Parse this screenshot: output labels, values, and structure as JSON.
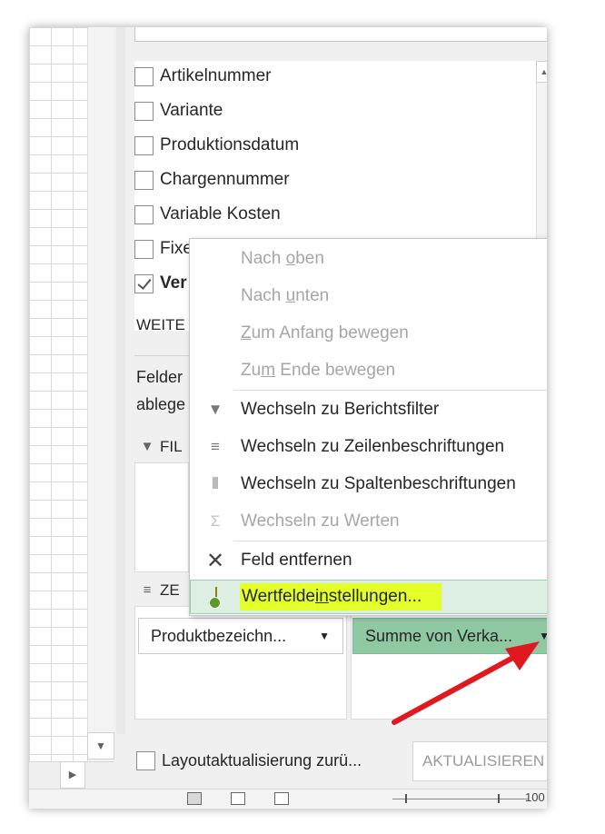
{
  "field_list": {
    "fields": [
      {
        "label": "Artikelnummer",
        "checked": false
      },
      {
        "label": "Variante",
        "checked": false
      },
      {
        "label": "Produktionsdatum",
        "checked": false
      },
      {
        "label": "Chargennummer",
        "checked": false
      },
      {
        "label": "Variable Kosten",
        "checked": false
      },
      {
        "label": "Fixe",
        "checked": false
      },
      {
        "label": "Ver",
        "checked": true
      }
    ],
    "more_tables": "WEITE"
  },
  "instructions": {
    "line1": "Felder",
    "line2": "ablege"
  },
  "areas": {
    "filter_header": "FIL",
    "rows_header": "ZE",
    "row_chip": "Produktbezeichn...",
    "value_chip": "Summe von Verka..."
  },
  "context_menu": {
    "items": [
      {
        "pre": "Nach ",
        "ul": "o",
        "post": "ben",
        "icon": "",
        "disabled": true
      },
      {
        "pre": "Nach ",
        "ul": "u",
        "post": "nten",
        "icon": "",
        "disabled": true
      },
      {
        "pre": "",
        "ul": "Z",
        "post": "um Anfang bewegen",
        "icon": "",
        "disabled": true
      },
      {
        "pre": "Zu",
        "ul": "m",
        "post": " Ende bewegen",
        "icon": "",
        "disabled": true
      },
      {
        "pre": "Wechseln zu Berichtsfilter",
        "ul": "",
        "post": "",
        "icon": "filter-icon",
        "disabled": false
      },
      {
        "pre": "Wechseln zu Zeilenbeschriftungen",
        "ul": "",
        "post": "",
        "icon": "rows-icon",
        "disabled": false
      },
      {
        "pre": "Wechseln zu Spaltenbeschriftungen",
        "ul": "",
        "post": "",
        "icon": "columns-icon",
        "disabled": false
      },
      {
        "pre": "Wechseln zu Werten",
        "ul": "",
        "post": "",
        "icon": "sigma-icon",
        "disabled": true
      },
      {
        "pre": "Feld entfernen",
        "ul": "",
        "post": "",
        "icon": "remove-icon",
        "disabled": false
      },
      {
        "pre": "Wertfelde",
        "ul": "in",
        "post": "stellungen...",
        "icon": "field-settings-icon",
        "disabled": false,
        "highlighted": true
      }
    ]
  },
  "bottom": {
    "defer_label": "Layoutaktualisierung zurü...",
    "update_label": "AKTUALISIEREN",
    "zoom": "100"
  },
  "colors": {
    "highlight": "#e4ff2a",
    "values_chip": "#8fc9a3",
    "arrow": "#e0181f"
  }
}
